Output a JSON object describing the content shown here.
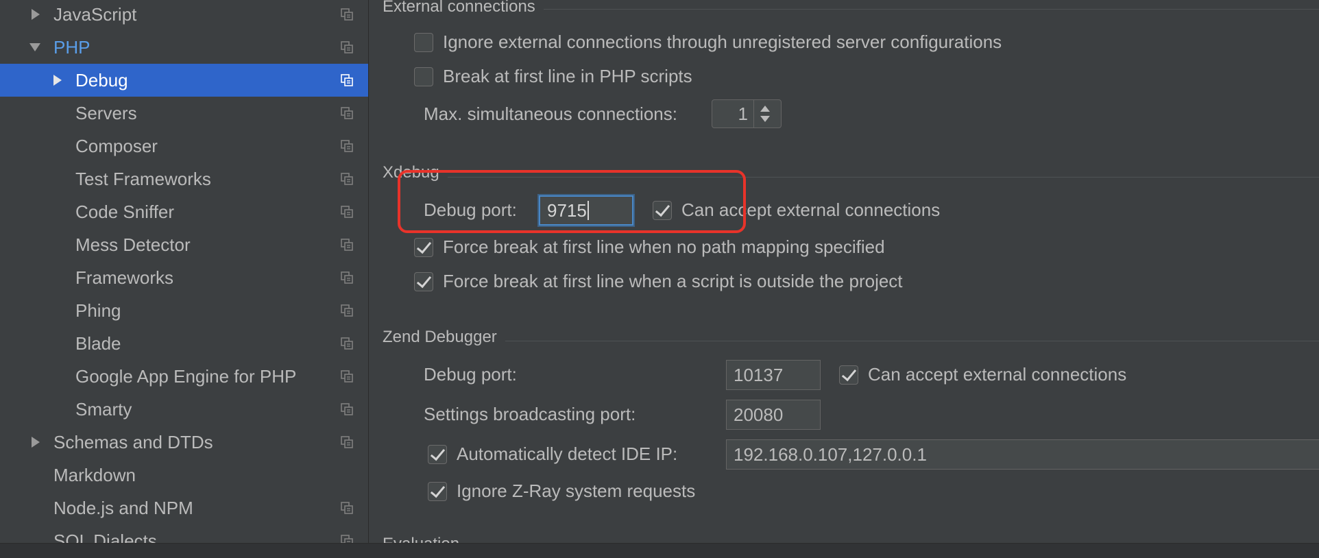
{
  "sidebar": {
    "items": [
      {
        "label": "JavaScript",
        "expander": "collapsed",
        "level": 0,
        "selected": false,
        "icon": "copy-icon"
      },
      {
        "label": "PHP",
        "expander": "expanded",
        "level": 0,
        "selected": false,
        "icon": "copy-icon",
        "link_color": "#5a9ee9"
      },
      {
        "label": "Debug",
        "expander": "collapsed",
        "level": 1,
        "selected": true,
        "icon": "copy-icon"
      },
      {
        "label": "Servers",
        "level": 1,
        "icon": "copy-icon"
      },
      {
        "label": "Composer",
        "level": 1,
        "icon": "copy-icon"
      },
      {
        "label": "Test Frameworks",
        "level": 1,
        "icon": "copy-icon"
      },
      {
        "label": "Code Sniffer",
        "level": 1,
        "icon": "copy-icon"
      },
      {
        "label": "Mess Detector",
        "level": 1,
        "icon": "copy-icon"
      },
      {
        "label": "Frameworks",
        "level": 1,
        "icon": "copy-icon"
      },
      {
        "label": "Phing",
        "level": 1,
        "icon": "copy-icon"
      },
      {
        "label": "Blade",
        "level": 1,
        "icon": "copy-icon"
      },
      {
        "label": "Google App Engine for PHP",
        "level": 1,
        "icon": "copy-icon"
      },
      {
        "label": "Smarty",
        "level": 1,
        "icon": "copy-icon"
      },
      {
        "label": "Schemas and DTDs",
        "expander": "collapsed",
        "level": 0,
        "icon": "copy-icon"
      },
      {
        "label": "Markdown",
        "level": 0
      },
      {
        "label": "Node.js and NPM",
        "level": 0,
        "icon": "copy-icon"
      },
      {
        "label": "SQL Dialects",
        "level": 0,
        "icon": "copy-icon"
      }
    ]
  },
  "external": {
    "title": "External connections",
    "ignore_unregistered": {
      "label": "Ignore external connections through unregistered server configurations",
      "checked": false
    },
    "break_first_line": {
      "label": "Break at first line in PHP scripts",
      "checked": false
    },
    "max_connections_label": "Max. simultaneous connections:",
    "max_connections_value": "1"
  },
  "xdebug": {
    "title": "Xdebug",
    "debug_port_label": "Debug port:",
    "debug_port_value": "9715",
    "accept_external": {
      "label": "Can accept external connections",
      "checked": true
    },
    "force_break_no_mapping": {
      "label": "Force break at first line when no path mapping specified",
      "checked": true
    },
    "force_break_outside": {
      "label": "Force break at first line when a script is outside the project",
      "checked": true
    }
  },
  "zend": {
    "title": "Zend Debugger",
    "debug_port_label": "Debug port:",
    "debug_port_value": "10137",
    "accept_external": {
      "label": "Can accept external connections",
      "checked": true
    },
    "broadcast_port_label": "Settings broadcasting port:",
    "broadcast_port_value": "20080",
    "auto_detect_ip": {
      "label": "Automatically detect IDE IP:",
      "checked": true
    },
    "ide_ip_value": "192.168.0.107,127.0.0.1",
    "ignore_zray": {
      "label": "Ignore Z-Ray system requests",
      "checked": true
    }
  },
  "next_section": {
    "title": "Evaluation"
  },
  "colors": {
    "background": "#3c3f41",
    "selection": "#2f65ca",
    "link": "#5a9ee9",
    "focus_border": "#4a88c7",
    "annotation_red": "#e8332a"
  }
}
